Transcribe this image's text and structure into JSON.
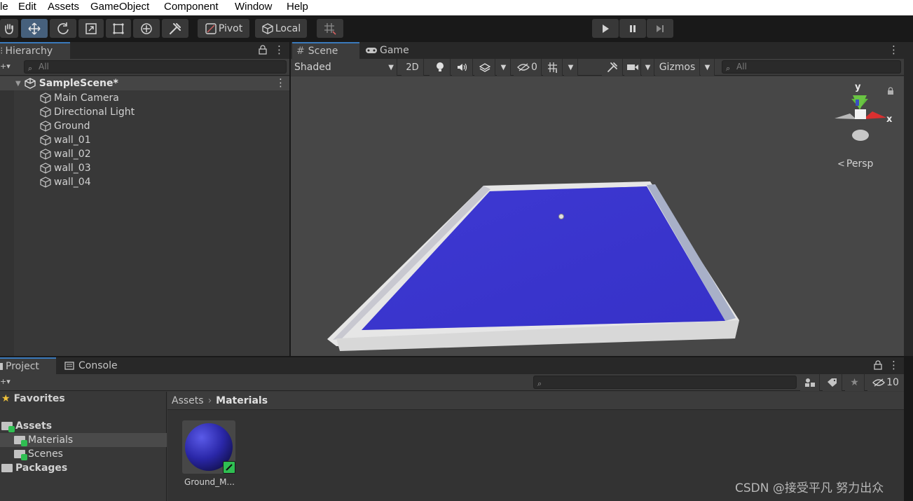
{
  "menu": [
    "le",
    "Edit",
    "Assets",
    "GameObject",
    "Component",
    "Window",
    "Help"
  ],
  "toolbar": {
    "pivot_label": "Pivot",
    "local_label": "Local"
  },
  "hierarchy": {
    "tab_label": "Hierarchy",
    "search_placeholder": "All",
    "scene_name": "SampleScene*",
    "items": [
      "Main Camera",
      "Directional Light",
      "Ground",
      "wall_01",
      "wall_02",
      "wall_03",
      "wall_04"
    ]
  },
  "scene_view": {
    "tabs": [
      "Scene",
      "Game"
    ],
    "shading_mode": "Shaded",
    "mode_2d_label": "2D",
    "hidden_count": "0",
    "gizmos_label": "Gizmos",
    "search_placeholder": "All",
    "axis_y": "y",
    "axis_x": "x",
    "projection_label": "Persp",
    "ground_color": "#3a35d0",
    "wall_color": "#e6e6e6",
    "background_color": "#474747"
  },
  "project": {
    "tabs": [
      "Project",
      "Console"
    ],
    "hidden_count": "10",
    "favorites_label": "Favorites",
    "tree": {
      "assets": "Assets",
      "materials": "Materials",
      "scenes": "Scenes",
      "packages": "Packages"
    },
    "breadcrumb": [
      "Assets",
      "Materials"
    ],
    "assets": [
      {
        "name": "Ground_M..."
      }
    ]
  },
  "watermark": "CSDN @接受平凡 努力出众",
  "colors": {
    "accent": "#3a79bb",
    "selected_tool": "#46607c",
    "check_badge": "#2fbf52"
  }
}
